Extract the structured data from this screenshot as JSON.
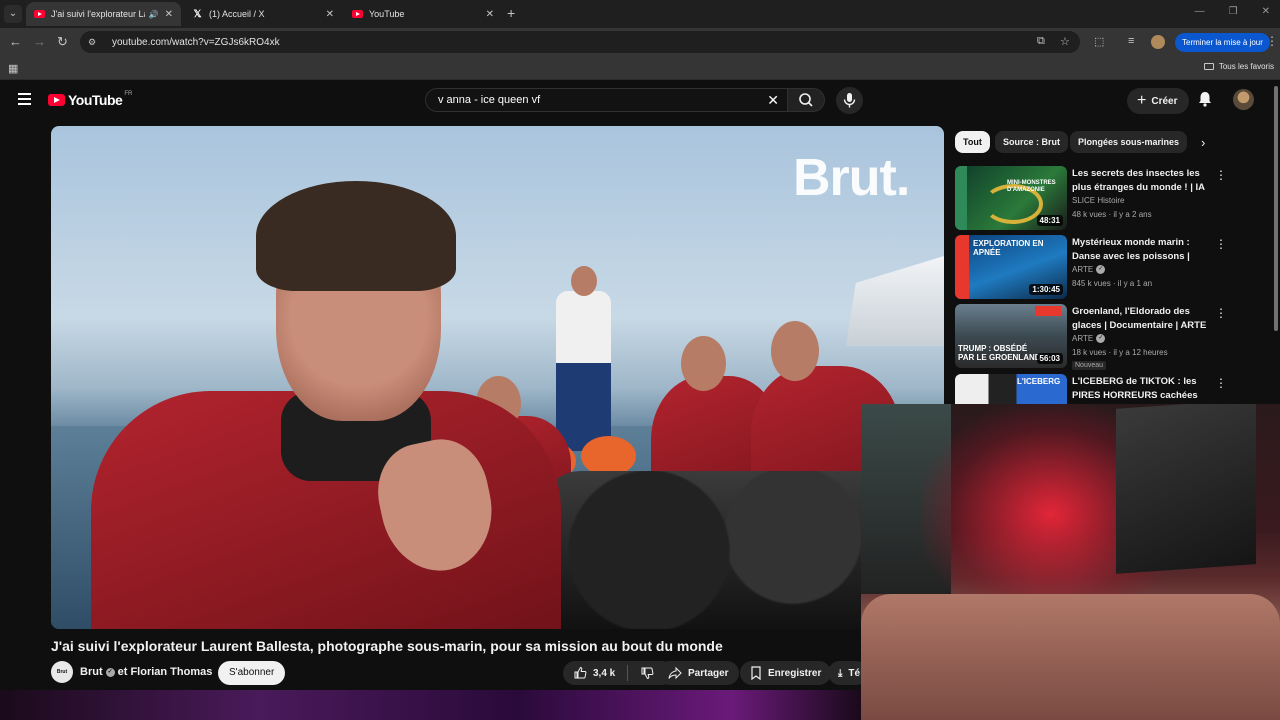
{
  "browser": {
    "tabs": [
      {
        "label": "J'ai suivi l'explorateur Laure",
        "icon": "youtube-favicon",
        "active": true
      },
      {
        "label": "(1) Accueil / X",
        "icon": "x-favicon",
        "active": false
      },
      {
        "label": "YouTube",
        "icon": "youtube-favicon",
        "active": false
      }
    ],
    "url": "youtube.com/watch?v=ZGJs6kRO4xk",
    "update_button": "Terminer la mise à jour",
    "bookmarks_label": "Tous les favoris"
  },
  "youtube": {
    "logo": "YouTube",
    "logo_country": "FR",
    "search_query": "v anna - ice queen vf",
    "create_label": "Créer",
    "accent_color": "#ff0033"
  },
  "video": {
    "title": "J'ai suivi l'explorateur Laurent Ballesta, photographe sous-marin, pour sa mission au bout du monde",
    "watermark": "Brut.",
    "channel_avatar_text": "Brut",
    "channel": "Brut",
    "collab": "et Florian Thomas",
    "subscribe": "S'abonner",
    "likes": "3,4 k",
    "share": "Partager",
    "save": "Enregistrer",
    "download": "Té"
  },
  "chips": [
    "Tout",
    "Source : Brut",
    "Plongées sous-marines"
  ],
  "recommendations": [
    {
      "title": "Les secrets des insectes les plus étranges du monde ! | IA |...",
      "channel": "SLICE Histoire",
      "verified": false,
      "meta": "48 k vues · il y a 2 ans",
      "duration": "48:31",
      "thumb_text": "MINI-MONSTRES D'AMAZONIE",
      "badge": ""
    },
    {
      "title": "Mystérieux monde marin : Danse avec les poissons | ARTE",
      "channel": "ARTE",
      "verified": true,
      "meta": "845 k vues · il y a 1 an",
      "duration": "1:30:45",
      "thumb_text": "EXPLORATION EN APNÉE",
      "badge": ""
    },
    {
      "title": "Groenland, l'Eldorado des glaces | Documentaire | ARTE",
      "channel": "ARTE",
      "verified": true,
      "meta": "18 k vues · il y a 12 heures",
      "duration": "56:03",
      "thumb_text": "TRUMP : OBSÉDÉ PAR LE GROENLAND",
      "badge": "Nouveau"
    },
    {
      "title": "L'ICEBERG de TIKTOK : les PIRES HORREURS cachées de...",
      "channel": "",
      "verified": false,
      "meta": "",
      "duration": "",
      "thumb_text": "L'ICEBERG",
      "badge": ""
    }
  ]
}
